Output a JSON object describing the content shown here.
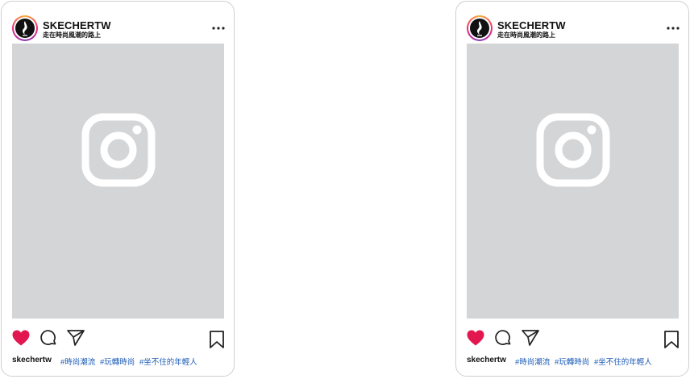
{
  "posts": [
    {
      "username": "SKECHERTW",
      "tagline": "走在時尚風潮的路上",
      "caption_user": "skechertw",
      "hashtags": [
        "#時尚潮流",
        "#玩轉時尚",
        "#坐不住的年輕人"
      ],
      "liked": true
    },
    {
      "username": "SKECHERTW",
      "tagline": "走在時尚風潮的路上",
      "caption_user": "skechertw",
      "hashtags": [
        "#時尚潮流",
        "#玩轉時尚",
        "#坐不住的年輕人"
      ],
      "liked": true
    }
  ],
  "colors": {
    "heart": "#e3174f",
    "hashtag": "#1a5ab6",
    "photo_placeholder": "#d4d5d7",
    "border": "#cfcfcf"
  },
  "icons": {
    "more": "more-horizontal-icon",
    "like": "heart-icon",
    "comment": "comment-icon",
    "share": "paper-plane-icon",
    "save": "bookmark-icon",
    "placeholder": "instagram-camera-icon"
  }
}
